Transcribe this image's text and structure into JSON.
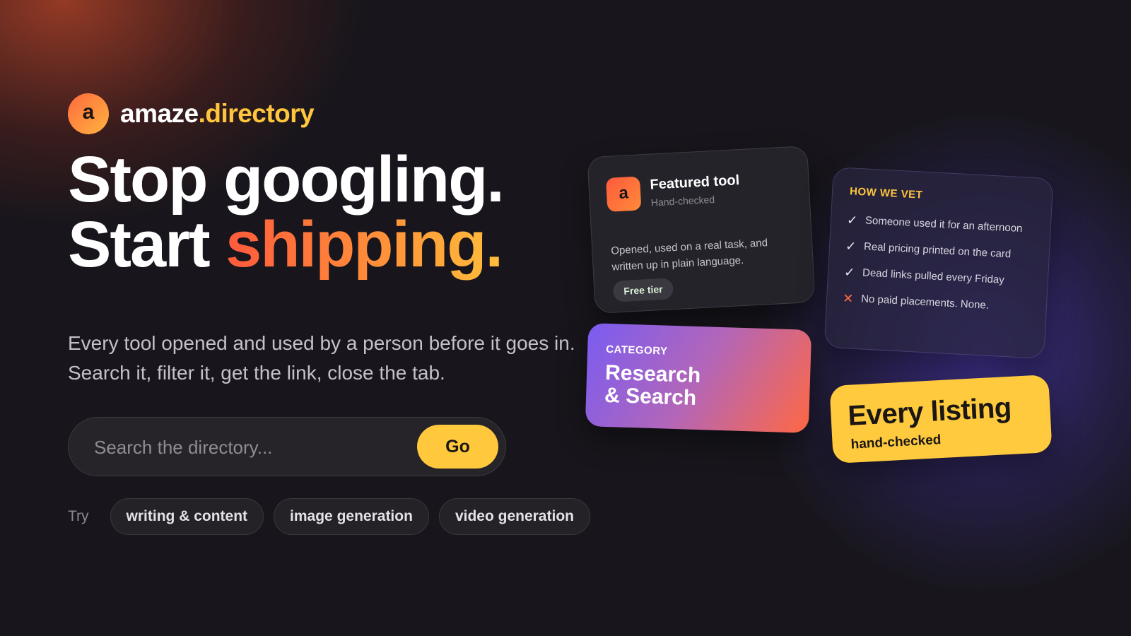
{
  "brand": {
    "logo_letter": "a",
    "name_main": "amaze",
    "name_tld": ".directory"
  },
  "hero": {
    "headline_line1": "Stop googling.",
    "headline_line2_plain": "Start ",
    "headline_line2_accent": "shipping.",
    "subtitle": "Every tool opened and used by a person before it goes in. Search it, filter it, get the link, close the tab."
  },
  "search": {
    "placeholder": "Search the directory...",
    "value": "",
    "button_label": "Go"
  },
  "try": {
    "label": "Try",
    "chips": [
      "writing & content",
      "image generation",
      "video generation"
    ]
  },
  "featured": {
    "logo_letter": "a",
    "title": "Featured tool",
    "subtitle": "Hand-checked",
    "description": "Opened, used on a real task, and written up in plain language.",
    "badge": "Free tier"
  },
  "vetting": {
    "heading": "HOW WE VET",
    "items": [
      {
        "icon": "check-icon",
        "symbol": "✓",
        "text": "Someone used it for an afternoon"
      },
      {
        "icon": "check-icon",
        "symbol": "✓",
        "text": "Real pricing printed on the card"
      },
      {
        "icon": "check-icon",
        "symbol": "✓",
        "text": "Dead links pulled every Friday"
      },
      {
        "icon": "cross-icon",
        "symbol": "✕",
        "text": "No paid placements. None."
      }
    ]
  },
  "category": {
    "label": "CATEGORY",
    "name_line1": "Research",
    "name_line2": "& Search"
  },
  "listing": {
    "title": "Every listing",
    "subtitle": "hand-checked"
  },
  "colors": {
    "background": "#18161c",
    "accent_yellow": "#ffc83d",
    "accent_orange": "#ff6a3d",
    "accent_purple": "#7a5cf2"
  }
}
